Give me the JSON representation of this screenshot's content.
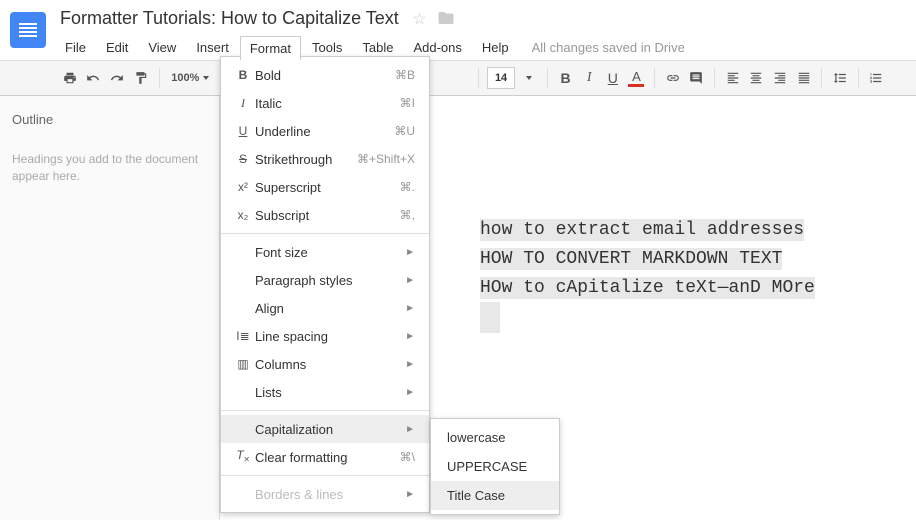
{
  "doc": {
    "title": "Formatter Tutorials: How to Capitalize Text",
    "save_status": "All changes saved in Drive"
  },
  "menu": {
    "file": "File",
    "edit": "Edit",
    "view": "View",
    "insert": "Insert",
    "format": "Format",
    "tools": "Tools",
    "table": "Table",
    "addons": "Add-ons",
    "help": "Help"
  },
  "toolbar": {
    "zoom": "100%",
    "font_size": "14"
  },
  "outline": {
    "title": "Outline",
    "hint": "Headings you add to the document appear here."
  },
  "format_menu": {
    "bold": {
      "label": "Bold",
      "shortcut": "⌘B"
    },
    "italic": {
      "label": "Italic",
      "shortcut": "⌘I"
    },
    "underline": {
      "label": "Underline",
      "shortcut": "⌘U"
    },
    "strike": {
      "label": "Strikethrough",
      "shortcut": "⌘+Shift+X"
    },
    "superscript": {
      "label": "Superscript",
      "shortcut": "⌘."
    },
    "subscript": {
      "label": "Subscript",
      "shortcut": "⌘,"
    },
    "font_size": {
      "label": "Font size"
    },
    "paragraph_styles": {
      "label": "Paragraph styles"
    },
    "align": {
      "label": "Align"
    },
    "line_spacing": {
      "label": "Line spacing"
    },
    "columns": {
      "label": "Columns"
    },
    "lists": {
      "label": "Lists"
    },
    "capitalization": {
      "label": "Capitalization"
    },
    "clear": {
      "label": "Clear formatting",
      "shortcut": "⌘\\"
    },
    "borders": {
      "label": "Borders & lines"
    }
  },
  "capitalization_submenu": {
    "lowercase": "lowercase",
    "uppercase": "UPPERCASE",
    "titlecase": "Title Case"
  },
  "doc_content": {
    "line1": "how to extract email addresses",
    "line2": "HOW TO CONVERT MARKDOWN TEXT",
    "line3": "HOw to cApitalize teXt—anD MOre"
  }
}
